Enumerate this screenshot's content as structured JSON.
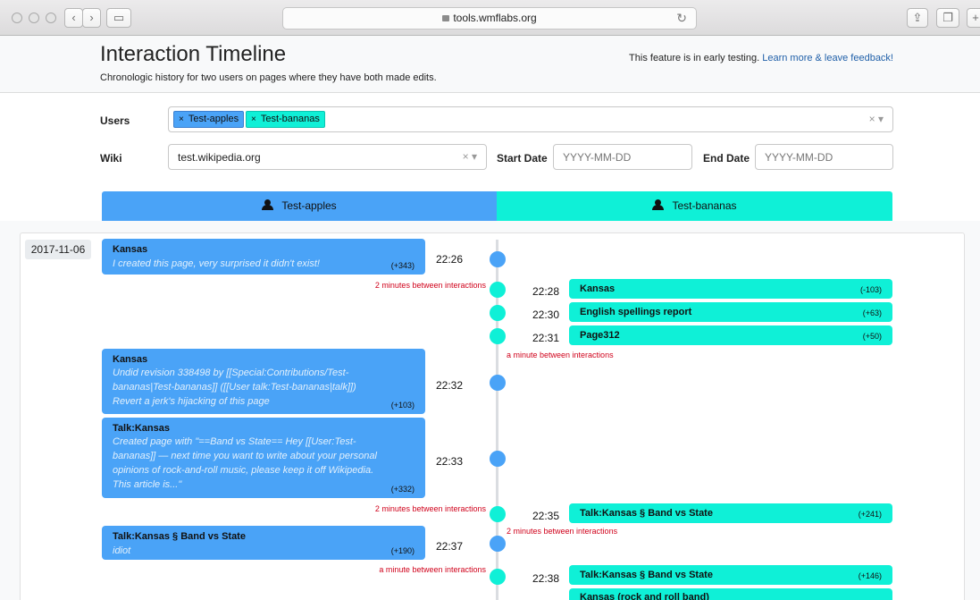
{
  "browser": {
    "url": "tools.wmflabs.org"
  },
  "header": {
    "title": "Interaction Timeline",
    "subtitle": "Chronologic history for two users on pages where they have both made edits.",
    "notice_text": "This feature is in early testing.",
    "notice_link": "Learn more & leave feedback!"
  },
  "form": {
    "users_label": "Users",
    "users": [
      "Test-apples",
      "Test-bananas"
    ],
    "wiki_label": "Wiki",
    "wiki_value": "test.wikipedia.org",
    "start_label": "Start Date",
    "start_placeholder": "YYYY-MM-DD",
    "end_label": "End Date",
    "end_placeholder": "YYYY-MM-DD"
  },
  "columns": {
    "left_user": "Test-apples",
    "right_user": "Test-bananas"
  },
  "colors": {
    "left": "#4aa3f7",
    "right": "#0ff0d7",
    "gap": "#d0021b"
  },
  "timeline": {
    "date": "2017-11-06",
    "left_events": [
      {
        "title": "Kansas",
        "comment": "I created this page, very surprised it didn't exist!",
        "size": "(+343)",
        "time": "22:26"
      },
      {
        "title": "Kansas",
        "comment_lines": [
          "Undid revision 338498 by [[Special:Contributions/Test-",
          "bananas|Test-bananas]] ([[User talk:Test-bananas|talk]])",
          "Revert a jerk's hijacking of this page"
        ],
        "size": "(+103)",
        "time": "22:32"
      },
      {
        "title": "Talk:Kansas",
        "comment_lines": [
          "Created page with \"==Band vs State== Hey [[User:Test-",
          "bananas]] — next time you want to write about your personal",
          "opinions of rock-and-roll music, please keep it off Wikipedia.",
          "This article is...\""
        ],
        "size": "(+332)",
        "time": "22:33"
      },
      {
        "title": "Talk:Kansas § Band vs State",
        "comment": "idiot",
        "size": "(+190)",
        "time": "22:37"
      }
    ],
    "right_events": [
      {
        "title": "Kansas",
        "size": "(-103)",
        "time": "22:28"
      },
      {
        "title": "English spellings report",
        "size": "(+63)",
        "time": "22:30"
      },
      {
        "title": "Page312",
        "size": "(+50)",
        "time": "22:31"
      },
      {
        "title": "Talk:Kansas § Band vs State",
        "size": "(+241)",
        "time": "22:35"
      },
      {
        "title": "Talk:Kansas § Band vs State",
        "size": "(+146)",
        "time": "22:38"
      },
      {
        "title": "Kansas (rock and roll band)",
        "size": "",
        "time": ""
      }
    ],
    "gaps": [
      "2 minutes between interactions",
      "a minute between interactions",
      "2 minutes between interactions",
      "2 minutes between interactions",
      "a minute between interactions"
    ]
  }
}
